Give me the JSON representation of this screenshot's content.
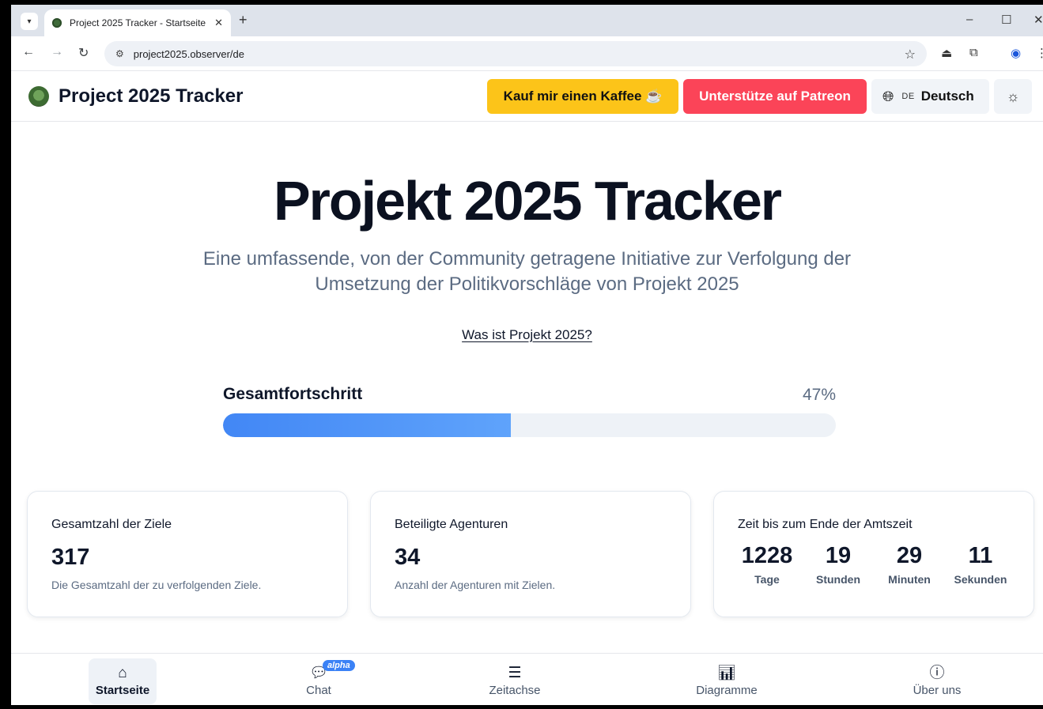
{
  "browser": {
    "tab_title": "Project 2025 Tracker - Startseite",
    "url": "project2025.observer/de"
  },
  "header": {
    "brand": "Project 2025 Tracker",
    "coffee_label": "Kauf mir einen Kaffee ☕",
    "patreon_label": "Unterstütze auf Patreon",
    "lang_code": "DE",
    "lang_name": "Deutsch"
  },
  "hero": {
    "title": "Projekt 2025 Tracker",
    "subtitle": "Eine umfassende, von der Community getragene Initiative zur Verfolgung der Umsetzung der Politikvorschläge von Projekt 2025",
    "link": "Was ist Projekt 2025?"
  },
  "progress": {
    "label": "Gesamtfortschritt",
    "value_text": "47%",
    "percent": 47
  },
  "cards": {
    "goals": {
      "title": "Gesamtzahl der Ziele",
      "value": "317",
      "desc": "Die Gesamtzahl der zu verfolgenden Ziele."
    },
    "agencies": {
      "title": "Beteiligte Agenturen",
      "value": "34",
      "desc": "Anzahl der Agenturen mit Zielen."
    },
    "countdown": {
      "title": "Zeit bis zum Ende der Amtszeit",
      "units": [
        {
          "value": "1228",
          "label": "Tage"
        },
        {
          "value": "19",
          "label": "Stunden"
        },
        {
          "value": "29",
          "label": "Minuten"
        },
        {
          "value": "11",
          "label": "Sekunden"
        }
      ]
    }
  },
  "bottom_nav": {
    "items": [
      {
        "label": "Startseite",
        "icon": "home-icon"
      },
      {
        "label": "Chat",
        "icon": "chat-icon",
        "badge": "alpha"
      },
      {
        "label": "Zeitachse",
        "icon": "list-icon"
      },
      {
        "label": "Diagramme",
        "icon": "bar-chart-icon"
      },
      {
        "label": "Über uns",
        "icon": "info-icon"
      }
    ]
  },
  "colors": {
    "coffee": "#fcc419",
    "patreon": "#fb4458",
    "progress": "#4287f5",
    "badge": "#3b82f6"
  }
}
